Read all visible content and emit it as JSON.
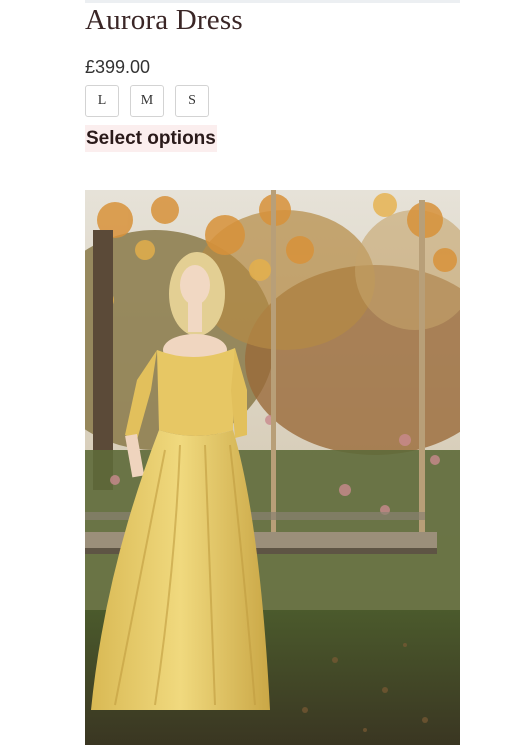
{
  "product": {
    "title": "Aurora Dress",
    "price": "£399.00",
    "sizes": [
      "L",
      "M",
      "S"
    ],
    "select_label": "Select options"
  },
  "colors": {
    "title": "#3a2626",
    "select_bg": "#fbeeee",
    "dress": "#e9cf6e"
  }
}
